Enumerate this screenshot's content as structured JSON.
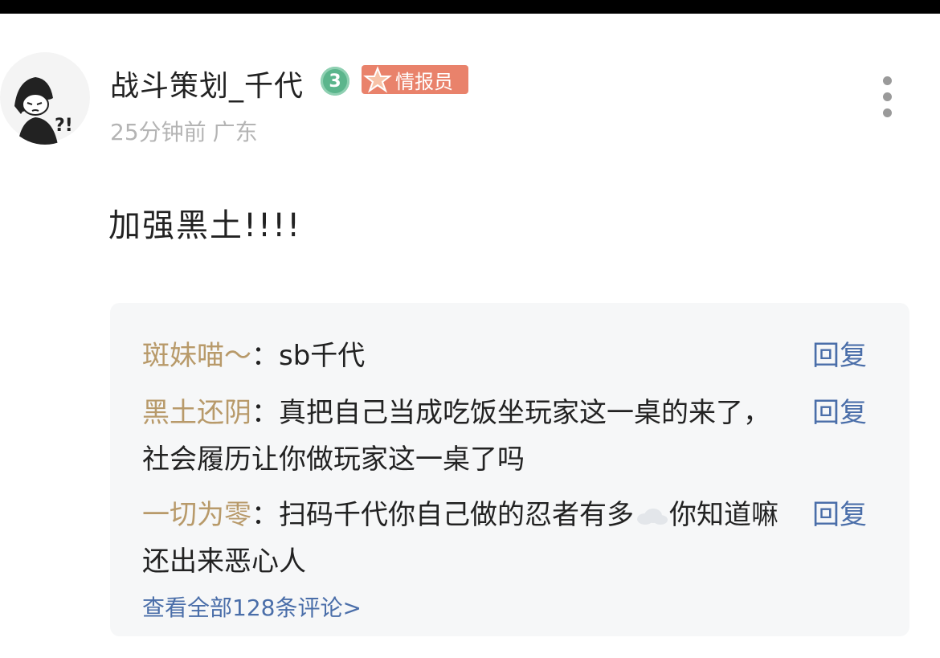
{
  "post": {
    "username": "战斗策划_千代",
    "level": "3",
    "role_badge": "情报员",
    "time": "25分钟前",
    "location": "广东",
    "content": "加强黑土!!!!",
    "avatar_mark": "?!"
  },
  "comments": [
    {
      "author": "斑妹喵～",
      "sep": "：",
      "text": "sb千代",
      "text2": "",
      "reply": "回复"
    },
    {
      "author": "黑土还阴",
      "sep": "：",
      "text": "真把自己当成吃饭坐玩家这一桌的来了，社会履历让你做玩家这一桌了吗",
      "text2": "",
      "reply": "回复"
    },
    {
      "author": "一切为零",
      "sep": "：",
      "text": "扫码千代你自己做的忍者有多",
      "text2": "你知道嘛还出来恶心人",
      "reply": "回复",
      "inline_icon": "cloud-emoji-icon"
    }
  ],
  "view_all": "查看全部128条评论>",
  "colors": {
    "author": "#b89a6a",
    "link": "#4a6ea9",
    "level_badge": "#5bb58c",
    "role_badge": "#e9826b"
  }
}
